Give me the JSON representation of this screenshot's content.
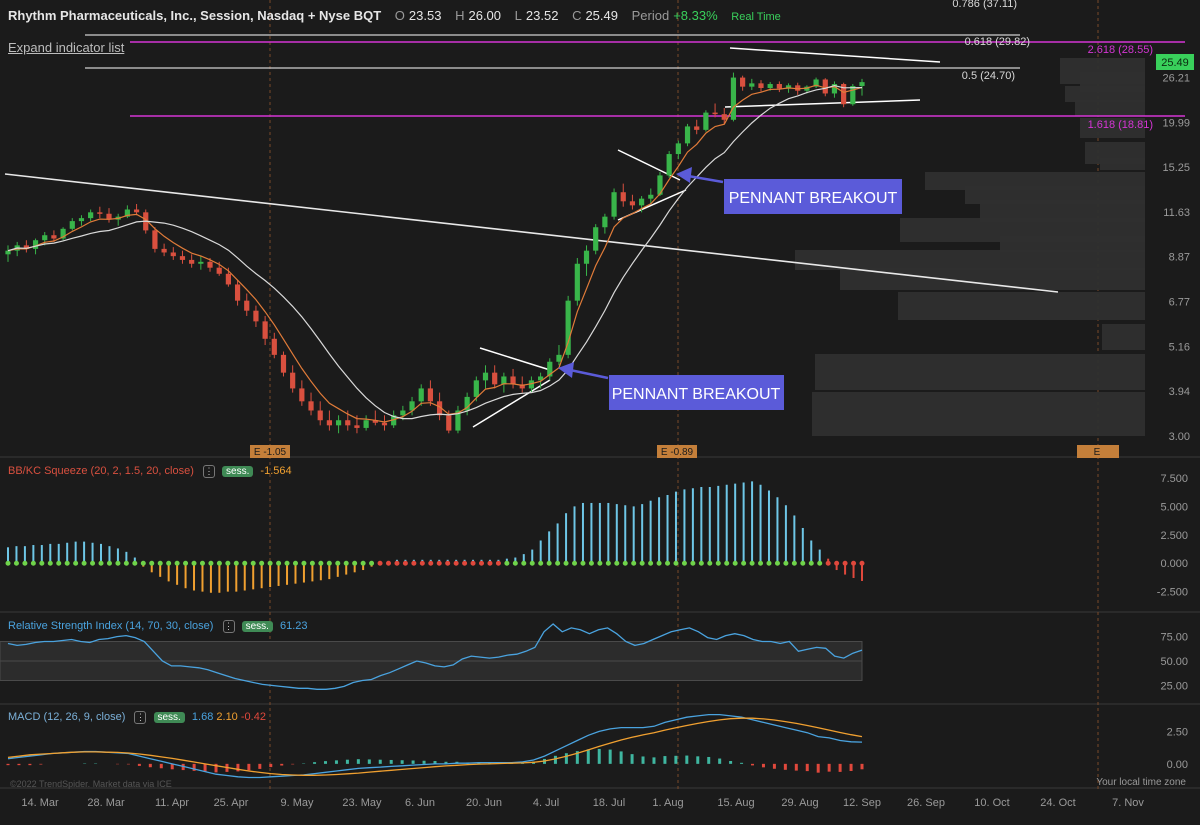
{
  "header": {
    "title": "Rhythm Pharmaceuticals, Inc., Session, Nasdaq + Nyse BQT",
    "open_label": "O",
    "open": "23.53",
    "high_label": "H",
    "high": "26.00",
    "low_label": "L",
    "low": "23.52",
    "close_label": "C",
    "close": "25.49",
    "period_label": "Period",
    "period": "+8.33%",
    "realtime": "Real Time"
  },
  "expand_label": "Expand indicator list",
  "annotations": [
    "PENNANT BREAKOUT",
    "PENNANT BREAKOUT"
  ],
  "earnings_labels": [
    "E -1.05",
    "E -0.89",
    "E"
  ],
  "fib_labels": [
    "0.786 (37.11)",
    "0.618 (29.82)",
    "0.5 (24.70)",
    "2.618 (28.55)",
    "1.618 (18.81)"
  ],
  "last_price_tag": "25.49",
  "panels": {
    "squeeze": {
      "label": "BB/KC Squeeze (20, 2, 1.5, 20, close)",
      "sess": "sess.",
      "value": "-1.564"
    },
    "rsi": {
      "label": "Relative Strength Index (14, 70, 30, close)",
      "sess": "sess.",
      "value": "61.23"
    },
    "macd": {
      "label": "MACD (12, 26, 9, close)",
      "sess": "sess.",
      "v1": "1.68",
      "v2": "2.10",
      "v3": "-0.42"
    }
  },
  "footer": {
    "copyright": "©2022 TrendSpider. Market data via ICE",
    "timezone": "Your local time zone"
  },
  "colors": {
    "bg": "#1b1b1b",
    "up": "#39b54a",
    "down": "#d9503f",
    "ema": "#e07b39",
    "sma": "#d9d9d9",
    "fib": "#d535d5",
    "callout": "#5b5bd9",
    "sq_pos": "#6ec6e6",
    "sq_neg": "#f0a030",
    "rsi": "#4aa3df",
    "macd": "#4aa3df",
    "signal": "#f0a030",
    "hist_pos": "#3fb6a0",
    "hist_neg": "#e0483c"
  },
  "chart_data": [
    {
      "type": "candlestick",
      "title": "Rhythm Pharmaceuticals, Inc., Session, Nasdaq + Nyse BQT",
      "x_labels": [
        "14. Mar",
        "28. Mar",
        "11. Apr",
        "25. Apr",
        "9. May",
        "23. May",
        "6. Jun",
        "20. Jun",
        "4. Jul",
        "18. Jul",
        "1. Aug",
        "15. Aug",
        "29. Aug",
        "12. Sep",
        "26. Sep",
        "10. Oct",
        "24. Oct",
        "7. Nov"
      ],
      "y_ticks": [
        "26.21",
        "19.99",
        "15.25",
        "11.63",
        "8.87",
        "6.77",
        "5.16",
        "3.94",
        "3.00"
      ],
      "y_scale": "log",
      "ylim": [
        3.0,
        37.11
      ],
      "last_price": 25.49,
      "fib_levels": [
        {
          "label": "0.786",
          "value": 37.11
        },
        {
          "label": "0.618",
          "value": 29.82
        },
        {
          "label": "0.5",
          "value": 24.7
        },
        {
          "label": "2.618",
          "value": 28.55
        },
        {
          "label": "1.618",
          "value": 18.81
        }
      ],
      "candles": [
        [
          9.0,
          9.5,
          8.6,
          9.2
        ],
        [
          9.2,
          9.7,
          8.9,
          9.5
        ],
        [
          9.5,
          9.8,
          9.1,
          9.3
        ],
        [
          9.3,
          9.9,
          9.0,
          9.8
        ],
        [
          9.8,
          10.3,
          9.5,
          10.1
        ],
        [
          10.1,
          10.4,
          9.7,
          9.9
        ],
        [
          9.9,
          10.6,
          9.8,
          10.5
        ],
        [
          10.5,
          11.2,
          10.4,
          11.0
        ],
        [
          11.0,
          11.4,
          10.7,
          11.2
        ],
        [
          11.2,
          11.8,
          11.0,
          11.6
        ],
        [
          11.6,
          12.0,
          11.2,
          11.5
        ],
        [
          11.5,
          11.9,
          10.9,
          11.1
        ],
        [
          11.1,
          11.5,
          10.7,
          11.3
        ],
        [
          11.3,
          12.1,
          11.2,
          11.8
        ],
        [
          11.8,
          12.2,
          11.4,
          11.6
        ],
        [
          11.6,
          11.8,
          10.2,
          10.4
        ],
        [
          10.4,
          10.6,
          9.1,
          9.3
        ],
        [
          9.3,
          9.6,
          8.9,
          9.1
        ],
        [
          9.1,
          9.4,
          8.7,
          8.9
        ],
        [
          8.9,
          9.2,
          8.5,
          8.7
        ],
        [
          8.7,
          9.0,
          8.3,
          8.5
        ],
        [
          8.5,
          8.9,
          8.2,
          8.6
        ],
        [
          8.6,
          8.8,
          8.1,
          8.3
        ],
        [
          8.3,
          8.6,
          7.9,
          8.0
        ],
        [
          8.0,
          8.3,
          7.4,
          7.5
        ],
        [
          7.5,
          7.7,
          6.6,
          6.8
        ],
        [
          6.8,
          7.1,
          6.2,
          6.4
        ],
        [
          6.4,
          6.6,
          5.8,
          6.0
        ],
        [
          6.0,
          6.2,
          5.2,
          5.4
        ],
        [
          5.4,
          5.6,
          4.8,
          4.9
        ],
        [
          4.9,
          5.0,
          4.3,
          4.4
        ],
        [
          4.4,
          4.6,
          3.9,
          4.0
        ],
        [
          4.0,
          4.2,
          3.6,
          3.7
        ],
        [
          3.7,
          3.9,
          3.4,
          3.5
        ],
        [
          3.5,
          3.7,
          3.2,
          3.3
        ],
        [
          3.3,
          3.5,
          3.1,
          3.2
        ],
        [
          3.2,
          3.4,
          3.05,
          3.3
        ],
        [
          3.3,
          3.5,
          3.1,
          3.2
        ],
        [
          3.2,
          3.4,
          3.05,
          3.15
        ],
        [
          3.15,
          3.4,
          3.1,
          3.3
        ],
        [
          3.3,
          3.5,
          3.2,
          3.25
        ],
        [
          3.25,
          3.4,
          3.1,
          3.2
        ],
        [
          3.2,
          3.5,
          3.15,
          3.4
        ],
        [
          3.4,
          3.6,
          3.3,
          3.5
        ],
        [
          3.5,
          3.8,
          3.4,
          3.7
        ],
        [
          3.7,
          4.1,
          3.6,
          4.0
        ],
        [
          4.0,
          4.2,
          3.6,
          3.7
        ],
        [
          3.7,
          3.9,
          3.3,
          3.4
        ],
        [
          3.4,
          3.5,
          3.05,
          3.1
        ],
        [
          3.1,
          3.6,
          3.05,
          3.5
        ],
        [
          3.5,
          3.9,
          3.4,
          3.8
        ],
        [
          3.8,
          4.3,
          3.7,
          4.2
        ],
        [
          4.2,
          4.6,
          4.0,
          4.4
        ],
        [
          4.4,
          4.6,
          4.0,
          4.1
        ],
        [
          4.1,
          4.4,
          3.9,
          4.3
        ],
        [
          4.3,
          4.5,
          4.0,
          4.1
        ],
        [
          4.1,
          4.3,
          3.9,
          4.0
        ],
        [
          4.0,
          4.3,
          3.9,
          4.2
        ],
        [
          4.2,
          4.4,
          4.0,
          4.3
        ],
        [
          4.3,
          4.8,
          4.2,
          4.7
        ],
        [
          4.7,
          5.2,
          4.6,
          4.9
        ],
        [
          4.9,
          7.0,
          4.8,
          6.8
        ],
        [
          6.8,
          8.8,
          6.6,
          8.5
        ],
        [
          8.5,
          9.5,
          7.9,
          9.2
        ],
        [
          9.2,
          10.8,
          9.0,
          10.6
        ],
        [
          10.6,
          11.5,
          10.2,
          11.3
        ],
        [
          11.3,
          13.4,
          11.1,
          13.1
        ],
        [
          13.1,
          13.8,
          12.0,
          12.4
        ],
        [
          12.4,
          12.9,
          11.8,
          12.1
        ],
        [
          12.1,
          12.8,
          11.6,
          12.6
        ],
        [
          12.6,
          13.4,
          12.2,
          12.9
        ],
        [
          12.9,
          14.8,
          12.8,
          14.5
        ],
        [
          14.5,
          16.8,
          14.3,
          16.5
        ],
        [
          16.5,
          17.9,
          16.0,
          17.6
        ],
        [
          17.6,
          19.8,
          17.3,
          19.5
        ],
        [
          19.5,
          20.3,
          18.6,
          19.1
        ],
        [
          19.1,
          21.5,
          18.9,
          21.2
        ],
        [
          21.2,
          22.4,
          20.6,
          21.0
        ],
        [
          21.0,
          21.8,
          19.8,
          20.3
        ],
        [
          20.3,
          27.0,
          20.1,
          26.2
        ],
        [
          26.2,
          26.5,
          24.2,
          24.8
        ],
        [
          24.8,
          26.0,
          24.3,
          25.3
        ],
        [
          25.3,
          25.8,
          24.1,
          24.6
        ],
        [
          24.6,
          25.5,
          24.2,
          25.2
        ],
        [
          25.2,
          25.6,
          24.0,
          24.5
        ],
        [
          24.5,
          25.3,
          23.9,
          25.0
        ],
        [
          25.0,
          25.4,
          23.6,
          24.2
        ],
        [
          24.2,
          25.0,
          23.8,
          24.8
        ],
        [
          24.8,
          26.2,
          24.6,
          25.9
        ],
        [
          25.9,
          26.1,
          23.4,
          23.8
        ],
        [
          23.8,
          25.6,
          23.2,
          25.2
        ],
        [
          25.2,
          25.4,
          21.9,
          22.3
        ],
        [
          22.3,
          25.2,
          22.1,
          24.9
        ],
        [
          24.9,
          26.0,
          23.5,
          25.49
        ]
      ]
    },
    {
      "type": "bar",
      "title": "BB/KC Squeeze (20, 2, 1.5, 20, close)",
      "y_ticks": [
        "7.500",
        "5.000",
        "2.500",
        "0.000",
        "-2.500"
      ],
      "ylim": [
        -3.5,
        8.2
      ],
      "values": [
        1.4,
        1.5,
        1.5,
        1.6,
        1.6,
        1.7,
        1.7,
        1.8,
        1.9,
        1.9,
        1.8,
        1.7,
        1.5,
        1.3,
        1.0,
        0.5,
        -0.3,
        -0.8,
        -1.2,
        -1.6,
        -1.9,
        -2.2,
        -2.4,
        -2.5,
        -2.6,
        -2.6,
        -2.5,
        -2.5,
        -2.4,
        -2.3,
        -2.2,
        -2.1,
        -2.0,
        -1.9,
        -1.8,
        -1.7,
        -1.6,
        -1.5,
        -1.4,
        -1.2,
        -1.0,
        -0.8,
        -0.6,
        -0.3,
        0.1,
        0.2,
        0.3,
        0.3,
        0.3,
        0.3,
        0.3,
        0.3,
        0.3,
        0.3,
        0.3,
        0.3,
        0.3,
        0.3,
        0.3,
        0.4,
        0.5,
        0.8,
        1.2,
        2.0,
        2.8,
        3.5,
        4.4,
        5.0,
        5.3,
        5.3,
        5.3,
        5.3,
        5.2,
        5.1,
        5.0,
        5.2,
        5.5,
        5.8,
        6.0,
        6.3,
        6.5,
        6.6,
        6.7,
        6.7,
        6.8,
        6.9,
        7.0,
        7.1,
        7.2,
        6.9,
        6.4,
        5.8,
        5.1,
        4.2,
        3.1,
        2.0,
        1.2,
        0.4,
        -0.6,
        -1.0,
        -1.3,
        -1.56
      ]
    },
    {
      "type": "line",
      "title": "Relative Strength Index (14, 70, 30, close)",
      "y_ticks": [
        "75.00",
        "50.00",
        "25.00"
      ],
      "ylim": [
        10,
        90
      ],
      "bands": [
        30,
        70
      ],
      "values": [
        68,
        66,
        67,
        69,
        70,
        70,
        71,
        72,
        70,
        69,
        72,
        73,
        75,
        76,
        74,
        70,
        60,
        50,
        45,
        45,
        44,
        43,
        41,
        38,
        35,
        32,
        30,
        28,
        26,
        25,
        24,
        23,
        22,
        22,
        21,
        21,
        22,
        24,
        28,
        30,
        31,
        35,
        38,
        42,
        46,
        50,
        48,
        45,
        44,
        46,
        52,
        55,
        54,
        53,
        54,
        56,
        57,
        60,
        64,
        80,
        88,
        80,
        84,
        82,
        78,
        82,
        84,
        78,
        70,
        66,
        68,
        72,
        76,
        80,
        82,
        84,
        80,
        74,
        72,
        76,
        78,
        76,
        72,
        70,
        70,
        68,
        70,
        60,
        62,
        64,
        63,
        55,
        53,
        58,
        61.23
      ]
    },
    {
      "type": "line",
      "title": "MACD (12, 26, 9, close)",
      "y_ticks": [
        "2.50",
        "0.00"
      ],
      "ylim": [
        -1.4,
        4.0
      ],
      "series": [
        {
          "name": "MACD",
          "values": [
            0.4,
            0.5,
            0.6,
            0.7,
            0.8,
            0.85,
            0.9,
            0.95,
            0.95,
            0.9,
            0.85,
            0.8,
            0.6,
            0.4,
            0.2,
            0.0,
            -0.2,
            -0.4,
            -0.6,
            -0.8,
            -0.9,
            -1.0,
            -1.05,
            -1.05,
            -1.0,
            -0.95,
            -0.9,
            -0.85,
            -0.75,
            -0.65,
            -0.55,
            -0.45,
            -0.35,
            -0.3,
            -0.25,
            -0.2,
            -0.15,
            -0.1,
            -0.05,
            0.0,
            0.0,
            0.05,
            0.05,
            0.1,
            0.1,
            0.1,
            0.1,
            0.15,
            0.3,
            0.6,
            1.0,
            1.4,
            1.8,
            2.2,
            2.5,
            2.7,
            2.8,
            2.8,
            2.8,
            2.9,
            3.2,
            3.4,
            3.6,
            3.7,
            3.8,
            3.8,
            3.7,
            3.6,
            3.4,
            3.2,
            3.0,
            2.8,
            2.6,
            2.4,
            2.1,
            2.0,
            1.8,
            1.7,
            1.68
          ]
        },
        {
          "name": "Signal",
          "values": [
            0.5,
            0.6,
            0.7,
            0.75,
            0.8,
            0.85,
            0.9,
            0.92,
            0.92,
            0.9,
            0.88,
            0.84,
            0.76,
            0.66,
            0.54,
            0.42,
            0.28,
            0.14,
            0.0,
            -0.14,
            -0.28,
            -0.42,
            -0.55,
            -0.66,
            -0.75,
            -0.82,
            -0.86,
            -0.88,
            -0.88,
            -0.86,
            -0.82,
            -0.77,
            -0.71,
            -0.64,
            -0.57,
            -0.5,
            -0.43,
            -0.36,
            -0.29,
            -0.22,
            -0.16,
            -0.11,
            -0.06,
            -0.02,
            0.0,
            0.03,
            0.05,
            0.07,
            0.12,
            0.22,
            0.38,
            0.58,
            0.82,
            1.08,
            1.35,
            1.6,
            1.84,
            2.05,
            2.23,
            2.4,
            2.6,
            2.78,
            2.96,
            3.12,
            3.27,
            3.39,
            3.48,
            3.52,
            3.52,
            3.47,
            3.38,
            3.26,
            3.12,
            2.96,
            2.78,
            2.6,
            2.42,
            2.25,
            2.1
          ]
        },
        {
          "name": "Histogram",
          "values": [
            -0.1,
            -0.1,
            -0.1,
            -0.05,
            0.0,
            0.0,
            0.0,
            0.03,
            0.03,
            0.0,
            -0.03,
            -0.04,
            -0.16,
            -0.26,
            -0.34,
            -0.42,
            -0.48,
            -0.54,
            -0.6,
            -0.66,
            -0.62,
            -0.58,
            -0.5,
            -0.39,
            -0.25,
            -0.13,
            -0.04,
            0.03,
            0.13,
            0.21,
            0.27,
            0.32,
            0.36,
            0.34,
            0.32,
            0.3,
            0.28,
            0.26,
            0.24,
            0.22,
            0.16,
            0.16,
            0.11,
            0.12,
            0.1,
            0.07,
            0.05,
            0.08,
            0.18,
            0.38,
            0.62,
            0.82,
            0.98,
            1.12,
            1.15,
            1.1,
            0.96,
            0.75,
            0.57,
            0.5,
            0.6,
            0.62,
            0.64,
            0.58,
            0.53,
            0.41,
            0.22,
            0.08,
            -0.12,
            -0.27,
            -0.38,
            -0.46,
            -0.52,
            -0.56,
            -0.68,
            -0.6,
            -0.62,
            -0.55,
            -0.42
          ]
        }
      ]
    }
  ]
}
